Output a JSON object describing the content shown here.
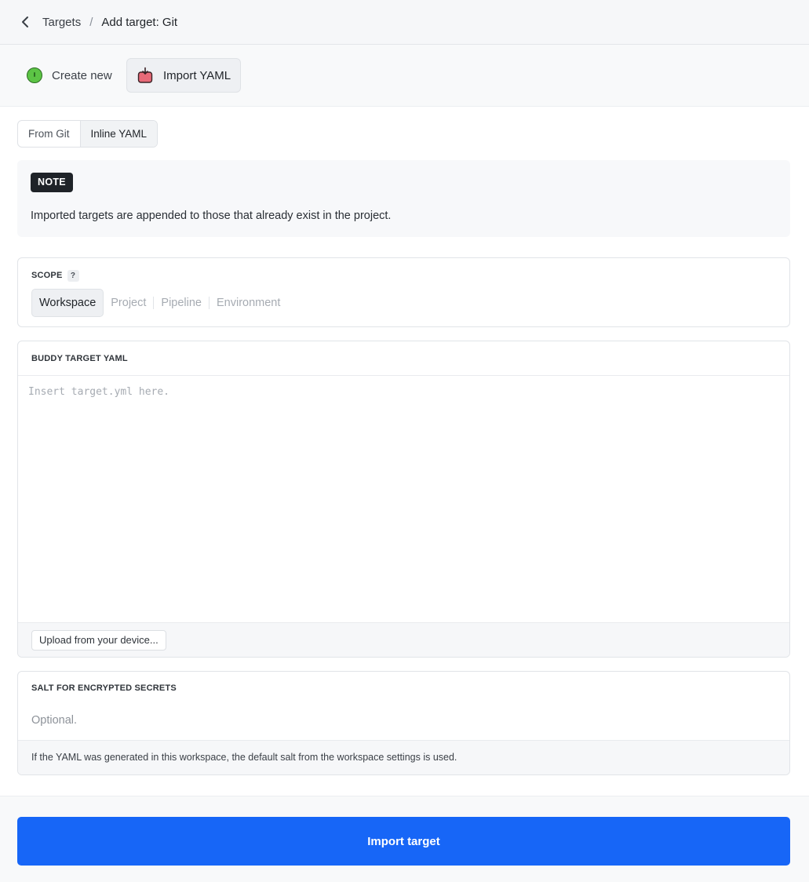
{
  "breadcrumb": {
    "parent": "Targets",
    "separator": "/",
    "current": "Add target: Git"
  },
  "mode_tabs": {
    "create_label": "Create new",
    "import_label": "Import YAML",
    "active": "import"
  },
  "source_tabs": {
    "from_git": "From Git",
    "inline_yaml": "Inline YAML",
    "active": "inline_yaml"
  },
  "note": {
    "badge": "NOTE",
    "text": "Imported targets are appended to those that already exist in the project."
  },
  "scope": {
    "label": "SCOPE",
    "help": "?",
    "options": [
      "Workspace",
      "Project",
      "Pipeline",
      "Environment"
    ],
    "selected": "Workspace"
  },
  "yaml_input": {
    "label": "BUDDY TARGET YAML",
    "placeholder": "Insert target.yml here.",
    "upload_label": "Upload from your device..."
  },
  "salt": {
    "label": "SALT FOR ENCRYPTED SECRETS",
    "placeholder": "Optional.",
    "hint": "If the YAML was generated in this workspace, the default salt from the workspace settings is used."
  },
  "submit_label": "Import target",
  "colors": {
    "primary": "#1766f7",
    "create_icon": "#5cc445",
    "import_icon": "#e86a78"
  }
}
